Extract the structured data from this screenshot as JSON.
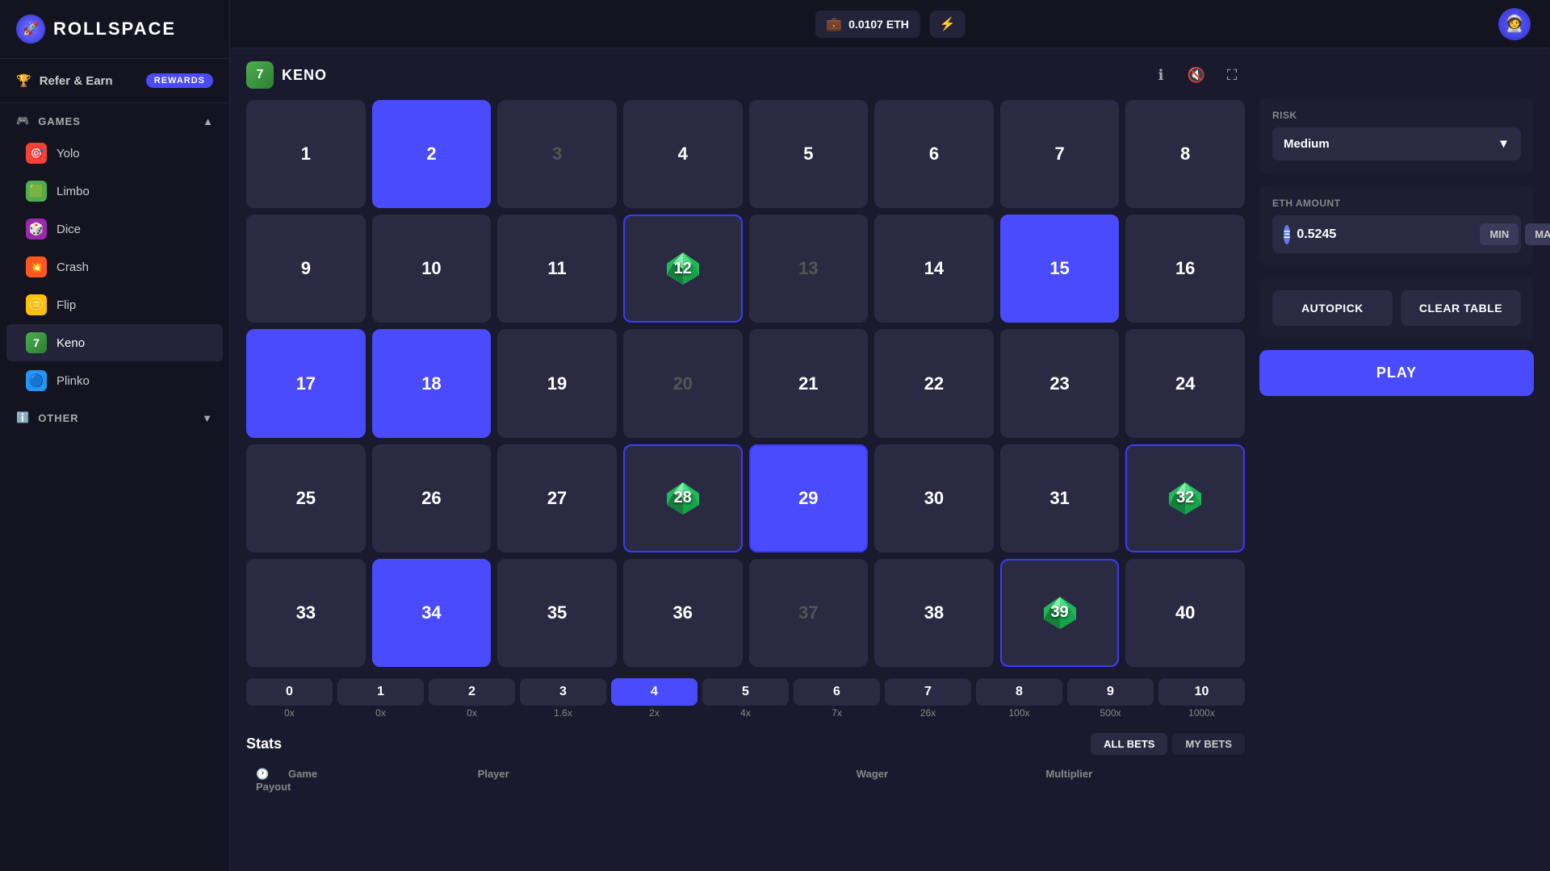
{
  "app": {
    "name": "ROLLSPACE",
    "logo_emoji": "🚀"
  },
  "header": {
    "wallet_amount": "0.0107 ETH",
    "wallet_icon": "💼",
    "bzz_icon": "⚡"
  },
  "sidebar": {
    "refer_label": "Refer & Earn",
    "rewards_badge": "REWARDS",
    "games_section": "GAMES",
    "games": [
      {
        "id": "yolo",
        "label": "Yolo",
        "emoji": "🎯",
        "color": "#f44336"
      },
      {
        "id": "limbo",
        "label": "Limbo",
        "emoji": "🟩",
        "color": "#4caf50"
      },
      {
        "id": "dice",
        "label": "Dice",
        "emoji": "🎲",
        "color": "#9c27b0"
      },
      {
        "id": "crash",
        "label": "Crash",
        "emoji": "💥",
        "color": "#ff5722"
      },
      {
        "id": "flip",
        "label": "Flip",
        "emoji": "🪙",
        "color": "#ffc107"
      },
      {
        "id": "keno",
        "label": "Keno",
        "emoji": "7",
        "color": "#4caf50",
        "active": true
      },
      {
        "id": "plinko",
        "label": "Plinko",
        "emoji": "🔵",
        "color": "#2196f3"
      }
    ],
    "other_section": "OTHER"
  },
  "game": {
    "title": "KENO",
    "icon_text": "7",
    "grid": [
      {
        "num": 1,
        "state": "normal"
      },
      {
        "num": 2,
        "state": "selected"
      },
      {
        "num": 3,
        "state": "inactive"
      },
      {
        "num": 4,
        "state": "normal"
      },
      {
        "num": 5,
        "state": "normal"
      },
      {
        "num": 6,
        "state": "normal"
      },
      {
        "num": 7,
        "state": "normal"
      },
      {
        "num": 8,
        "state": "normal"
      },
      {
        "num": 9,
        "state": "normal"
      },
      {
        "num": 10,
        "state": "normal"
      },
      {
        "num": 11,
        "state": "normal"
      },
      {
        "num": 12,
        "state": "gem"
      },
      {
        "num": 13,
        "state": "inactive"
      },
      {
        "num": 14,
        "state": "normal"
      },
      {
        "num": 15,
        "state": "selected"
      },
      {
        "num": 16,
        "state": "normal"
      },
      {
        "num": 17,
        "state": "selected"
      },
      {
        "num": 18,
        "state": "selected"
      },
      {
        "num": 19,
        "state": "normal"
      },
      {
        "num": 20,
        "state": "inactive"
      },
      {
        "num": 21,
        "state": "normal"
      },
      {
        "num": 22,
        "state": "normal"
      },
      {
        "num": 23,
        "state": "normal"
      },
      {
        "num": 24,
        "state": "normal"
      },
      {
        "num": 25,
        "state": "normal"
      },
      {
        "num": 26,
        "state": "normal"
      },
      {
        "num": 27,
        "state": "normal"
      },
      {
        "num": 28,
        "state": "gem"
      },
      {
        "num": 29,
        "state": "selected-hit"
      },
      {
        "num": 30,
        "state": "normal"
      },
      {
        "num": 31,
        "state": "normal"
      },
      {
        "num": 32,
        "state": "gem"
      },
      {
        "num": 33,
        "state": "normal"
      },
      {
        "num": 34,
        "state": "selected"
      },
      {
        "num": 35,
        "state": "normal"
      },
      {
        "num": 36,
        "state": "normal"
      },
      {
        "num": 37,
        "state": "inactive"
      },
      {
        "num": 38,
        "state": "normal"
      },
      {
        "num": 39,
        "state": "gem-hit"
      },
      {
        "num": 40,
        "state": "normal"
      }
    ],
    "payout_row": [
      {
        "num": 0,
        "mult": "0x",
        "active": false
      },
      {
        "num": 1,
        "mult": "0x",
        "active": false
      },
      {
        "num": 2,
        "mult": "0x",
        "active": false
      },
      {
        "num": 3,
        "mult": "1.6x",
        "active": false
      },
      {
        "num": 4,
        "mult": "2x",
        "active": true
      },
      {
        "num": 5,
        "mult": "4x",
        "active": false
      },
      {
        "num": 6,
        "mult": "7x",
        "active": false
      },
      {
        "num": 7,
        "mult": "26x",
        "active": false
      },
      {
        "num": 8,
        "mult": "100x",
        "active": false
      },
      {
        "num": 9,
        "mult": "500x",
        "active": false
      },
      {
        "num": 10,
        "mult": "1000x",
        "active": false
      }
    ]
  },
  "right_panel": {
    "risk_label": "RISK",
    "risk_value": "Medium",
    "eth_label": "ETH AMOUNT",
    "eth_value": "0.5245",
    "min_label": "MIN",
    "max_label": "MAX",
    "autopick_label": "AUTOPICK",
    "clear_label": "CLEAR TABLE",
    "play_label": "PLAY"
  },
  "stats": {
    "title": "Stats",
    "tabs": [
      "ALL BETS",
      "MY BETS"
    ],
    "columns": [
      "",
      "Game",
      "Player",
      "Wager",
      "Multiplier",
      "Payout"
    ]
  }
}
